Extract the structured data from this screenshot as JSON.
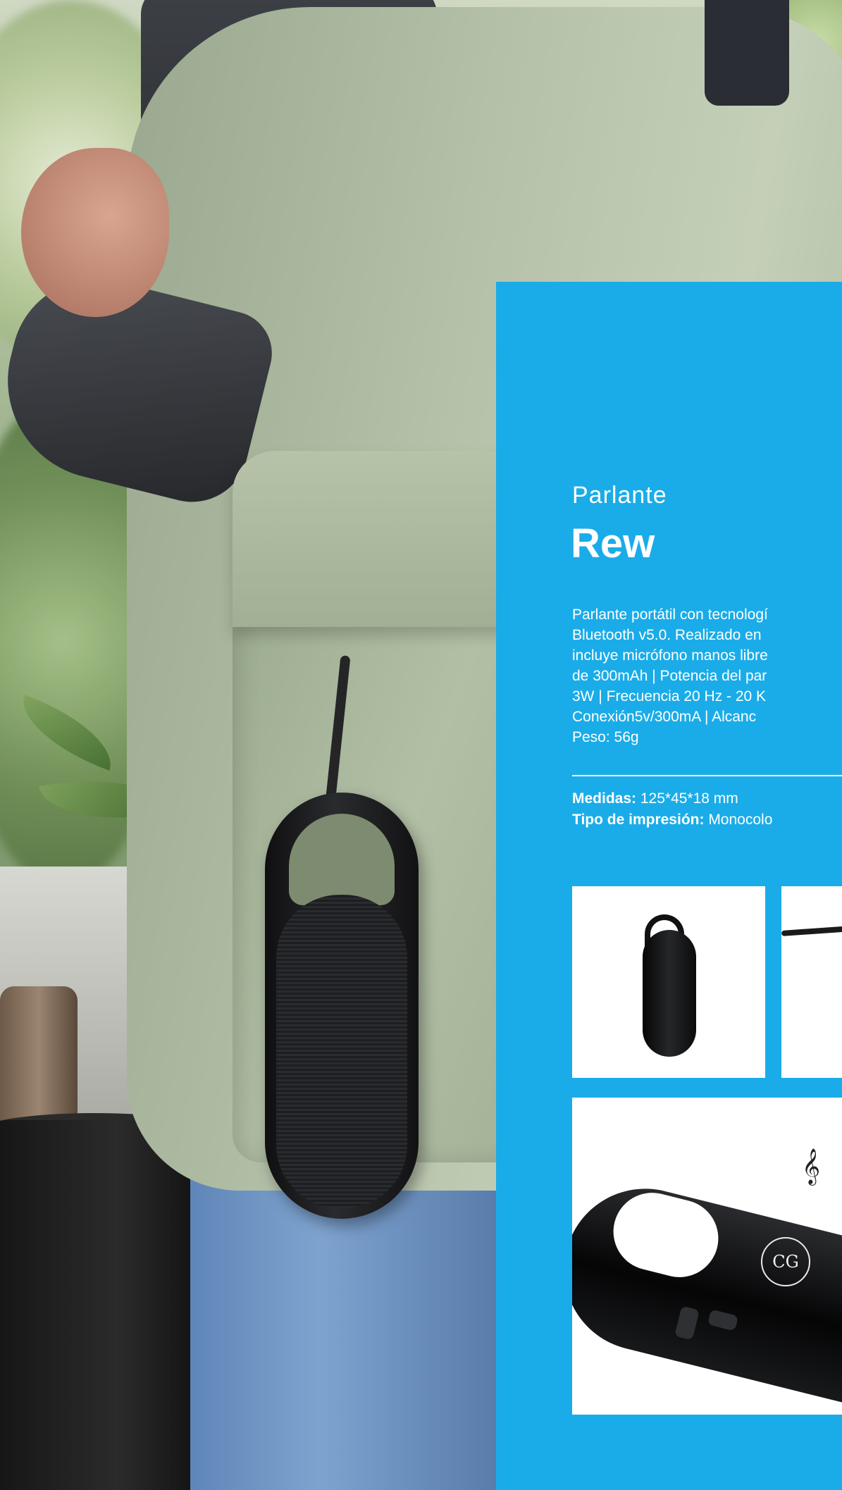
{
  "product": {
    "category": "Parlante",
    "name": "Rew",
    "description_lines": [
      "Parlante portátil con tecnologí",
      "Bluetooth v5.0. Realizado en",
      "incluye micrófono manos libre",
      "de 300mAh | Potencia del par",
      "3W | Frecuencia 20 Hz - 20 K",
      "Conexión5v/300mA | Alcanc",
      "Peso: 56g"
    ],
    "specs": [
      {
        "label": "Medidas:",
        "value": "125*45*18 mm"
      },
      {
        "label": "Tipo de impresión:",
        "value": "Monocolo"
      }
    ]
  },
  "images": {
    "thumbnail_1": "speaker-product-photo",
    "thumbnail_2": "speaker-with-cord-photo",
    "detail": "speaker-detail-photo",
    "logo_text": "CG"
  },
  "colors": {
    "panel_blue": "#1aace8",
    "text": "#ffffff",
    "speaker": "#121214"
  }
}
